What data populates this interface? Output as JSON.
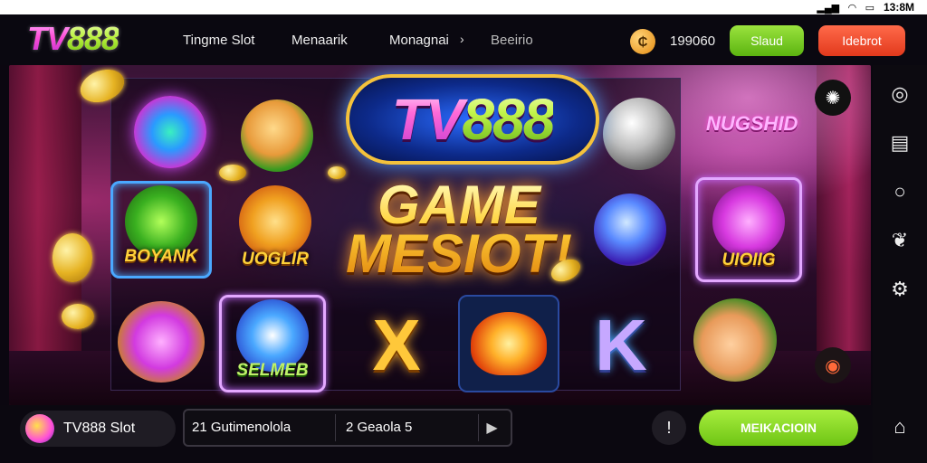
{
  "status_bar": {
    "time": "13:8M",
    "icons": [
      "signal-icon",
      "wifi-icon",
      "battery-icon"
    ]
  },
  "header": {
    "logo": {
      "prefix": "TV",
      "digits": "888"
    },
    "nav": [
      "Tingme Slot",
      "Menaarik",
      "Monagnai",
      "Beeirio"
    ],
    "balance": "199060",
    "green_button": "Slaud",
    "red_button": "Idebrot"
  },
  "scene": {
    "banner": {
      "prefix": "TV",
      "digits": "888"
    },
    "headline": [
      "GAME",
      "MESIOT!"
    ],
    "tiles": [
      "BOYANK",
      "UOGLIR",
      "UIOIIG",
      "SELMEB"
    ],
    "side_label": "NUGSHID"
  },
  "bottom": {
    "game_name": "TV888 Slot",
    "info_a": "21  Gutimenolola",
    "info_b": "2  Geaola  5",
    "cta": "MEIKACIOIN"
  },
  "colors": {
    "accent_green": "#7ccf1e",
    "accent_red": "#f04a2c",
    "brand_pink": "#ff4fd8",
    "gold": "#ffd23a"
  }
}
